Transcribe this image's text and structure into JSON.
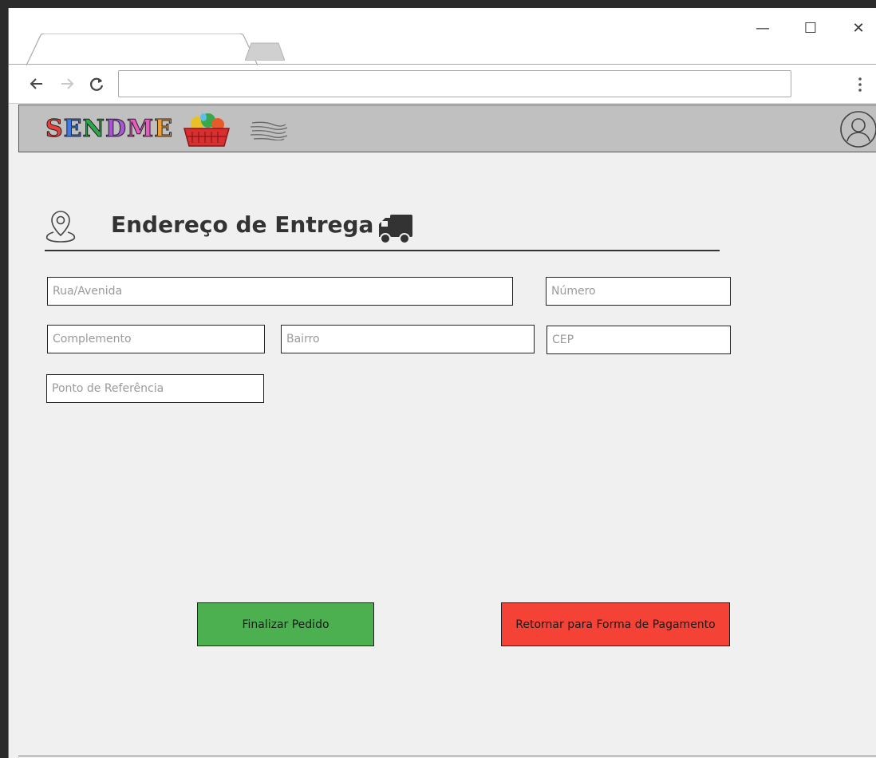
{
  "browser": {
    "address_value": "",
    "controls": {
      "minimize": "—",
      "maximize": "☐",
      "close": "✕"
    }
  },
  "header": {
    "logo_text": [
      "S",
      "E",
      "N",
      "D",
      "M",
      "E"
    ],
    "logo_colors": [
      "#e8403a",
      "#3a7be8",
      "#2aa84a",
      "#a855d8",
      "#e85ac0",
      "#f0a030"
    ],
    "background": "#c0c0c0"
  },
  "page": {
    "title": "Endereço de Entrega"
  },
  "form": {
    "street_placeholder": "Rua/Avenida",
    "number_placeholder": "Número",
    "complement_placeholder": "Complemento",
    "neighborhood_placeholder": "Bairro",
    "zip_placeholder": "CEP",
    "reference_placeholder": "Ponto de Referência"
  },
  "actions": {
    "finish_label": "Finalizar Pedido",
    "back_label": "Retornar para Forma de Pagamento",
    "finish_color": "#4caf50",
    "back_color": "#f44336"
  }
}
